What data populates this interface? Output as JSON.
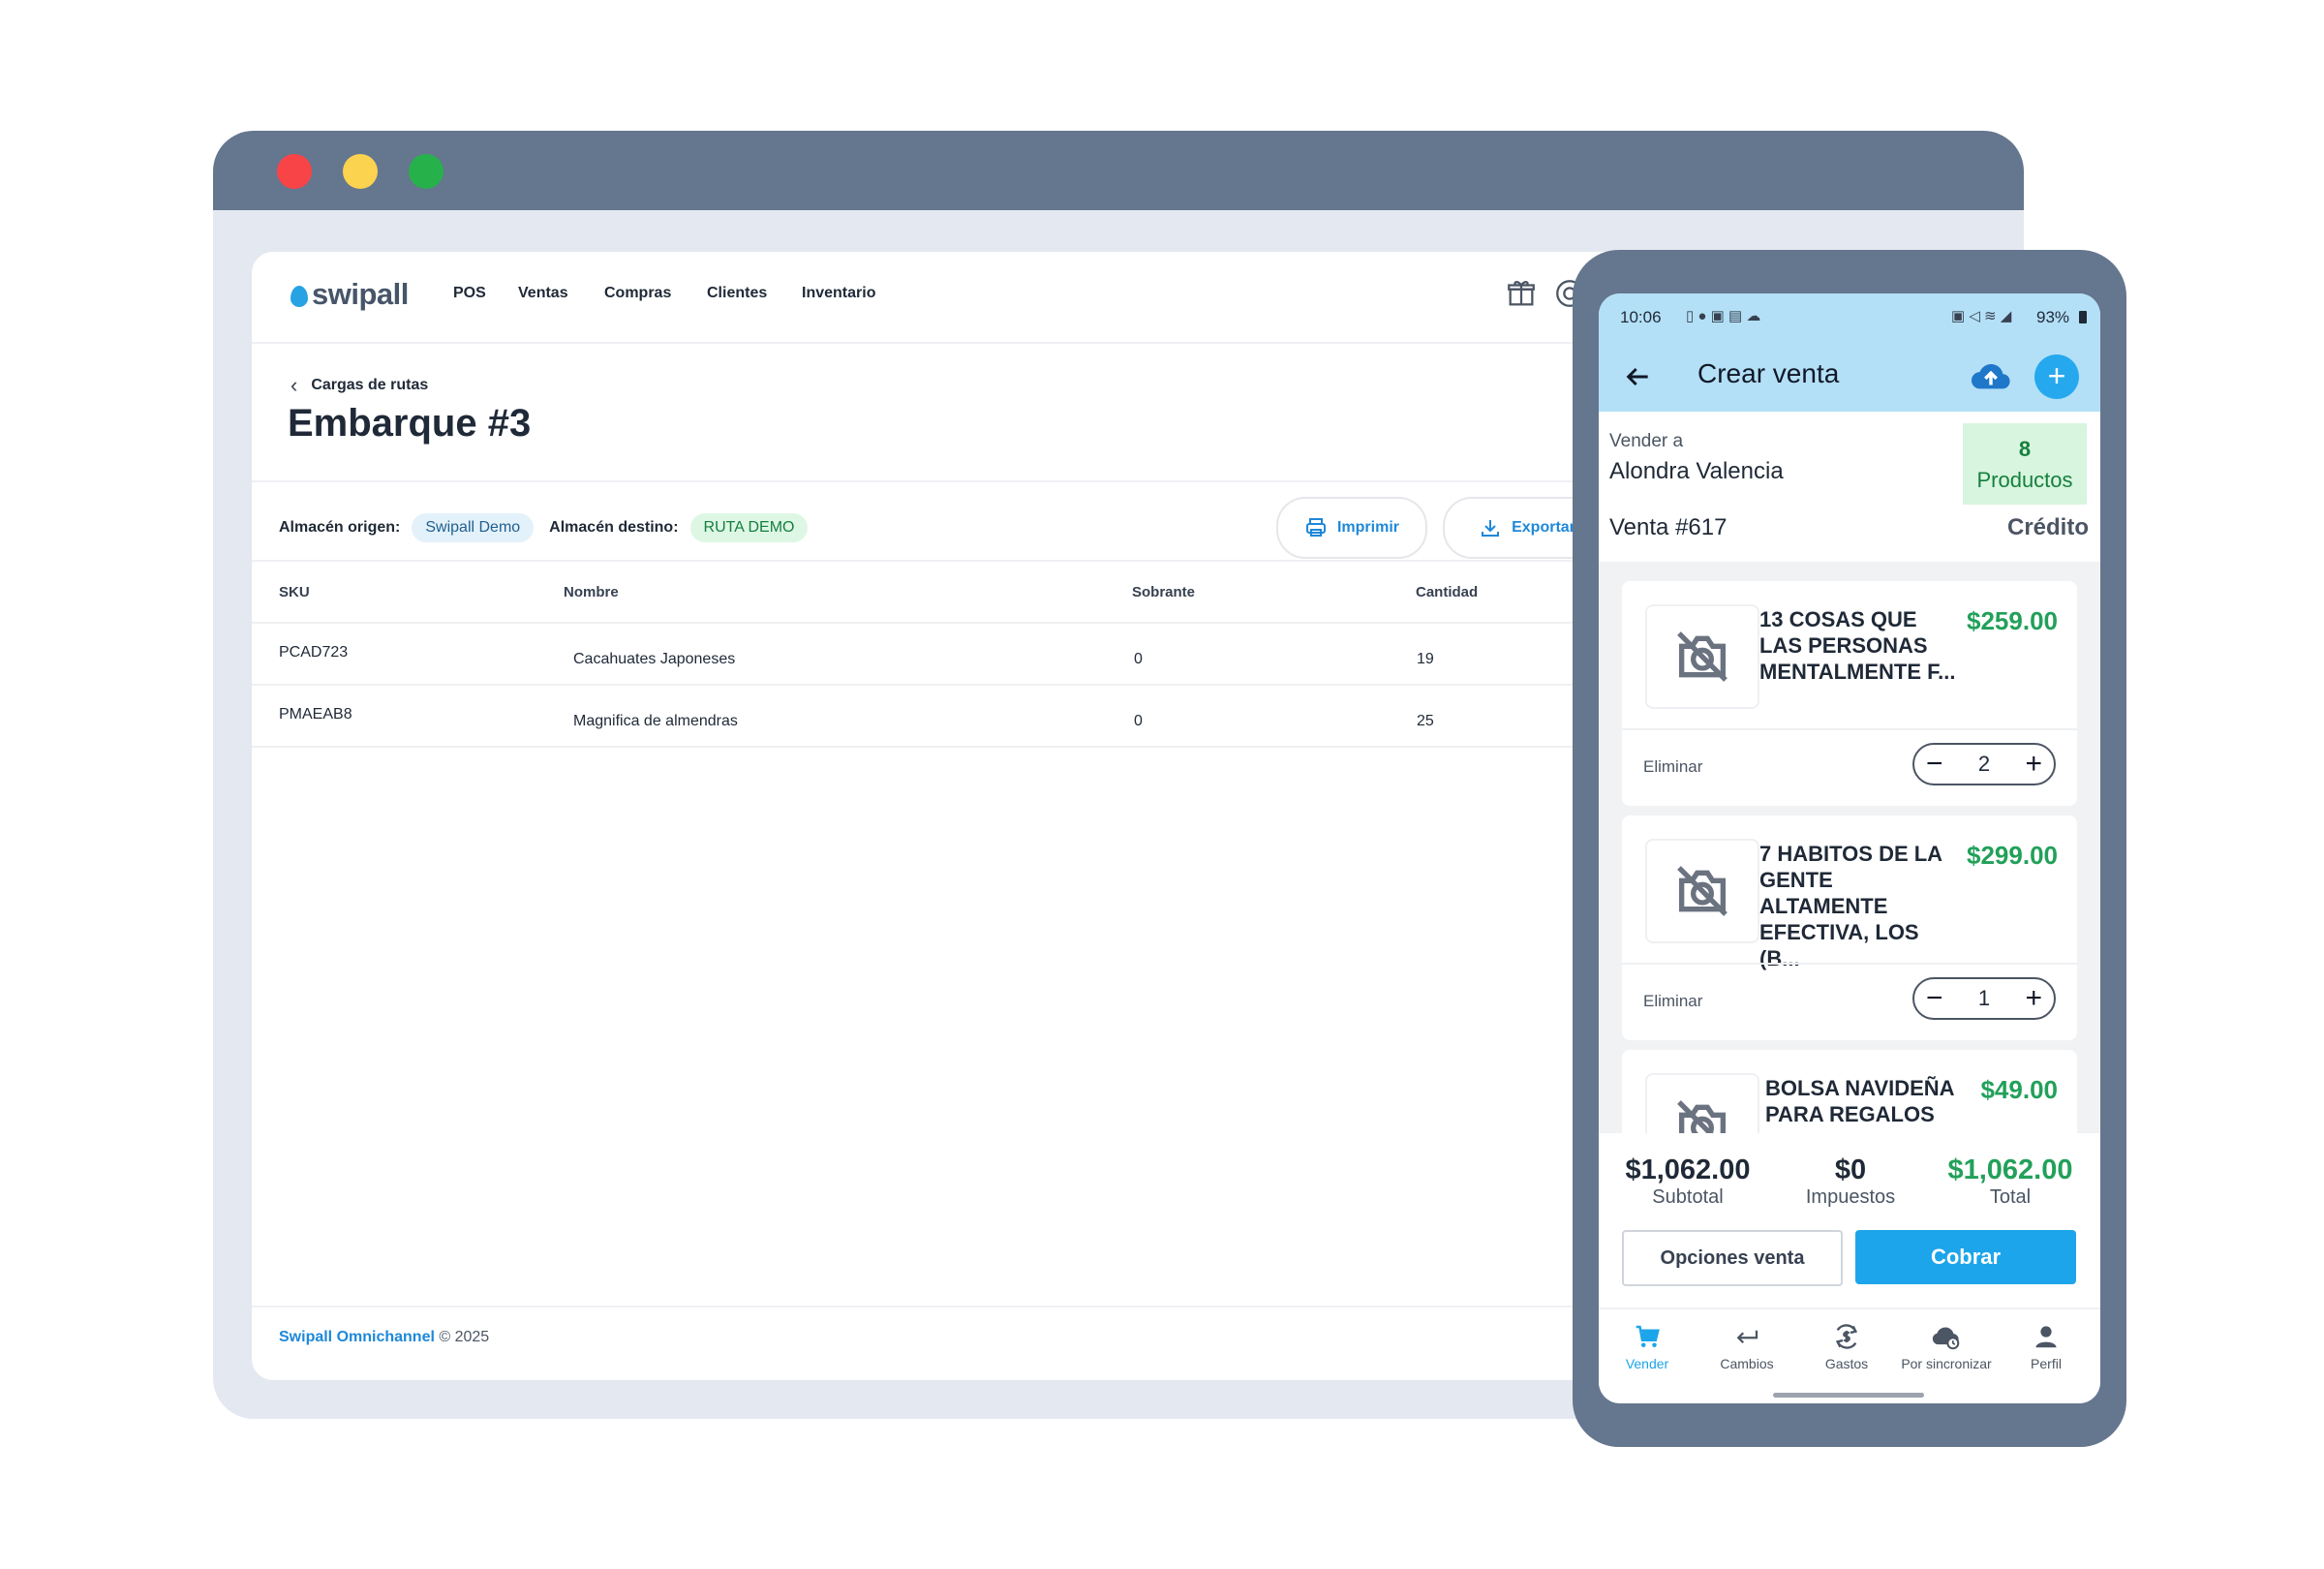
{
  "desktop": {
    "logo": "swipall",
    "nav": [
      "POS",
      "Ventas",
      "Compras",
      "Clientes",
      "Inventario"
    ],
    "breadcrumb": "Cargas de rutas",
    "title": "Embarque #3",
    "origin_label": "Almacén origen:",
    "origin_value": "Swipall Demo",
    "dest_label": "Almacén destino:",
    "dest_value": "RUTA DEMO",
    "print_label": "Imprimir",
    "export_label": "Exportar",
    "table": {
      "headers": [
        "SKU",
        "Nombre",
        "Sobrante",
        "Cantidad"
      ],
      "rows": [
        {
          "sku": "PCAD723",
          "name": "Cacahuates Japoneses",
          "leftover": "0",
          "qty": "19"
        },
        {
          "sku": "PMAEAB8",
          "name": "Magnifica de almendras",
          "leftover": "0",
          "qty": "25"
        }
      ]
    },
    "footer_brand": "Swipall Omnichannel",
    "footer_rest": "© 2025"
  },
  "phone": {
    "status_time": "10:06",
    "status_battery": "93%",
    "title": "Crear venta",
    "sell_to_label": "Vender a",
    "customer": "Alondra Valencia",
    "products_count": "8",
    "products_label": "Productos",
    "sale_number": "Venta #617",
    "payment_type": "Crédito",
    "items": [
      {
        "name": "13 COSAS QUE LAS PERSONAS MENTALMENTE F...",
        "price": "$259.00",
        "qty": "2",
        "remove": "Eliminar"
      },
      {
        "name": "7 HABITOS DE LA GENTE ALTAMENTE EFECTIVA, LOS (B...",
        "price": "$299.00",
        "qty": "1",
        "remove": "Eliminar"
      },
      {
        "name": "BOLSA NAVIDEÑA PARA REGALOS",
        "price": "$49.00"
      }
    ],
    "subtotal": "$1,062.00",
    "subtotal_label": "Subtotal",
    "taxes": "$0",
    "taxes_label": "Impuestos",
    "total": "$1,062.00",
    "total_label": "Total",
    "options_button": "Opciones venta",
    "pay_button": "Cobrar",
    "bottom_nav": [
      "Vender",
      "Cambios",
      "Gastos",
      "Por sincronizar",
      "Perfil"
    ],
    "colors": {
      "accent": "#1ca5ea",
      "price_green": "#22a05a",
      "header_bg": "#b3e0f7"
    }
  }
}
